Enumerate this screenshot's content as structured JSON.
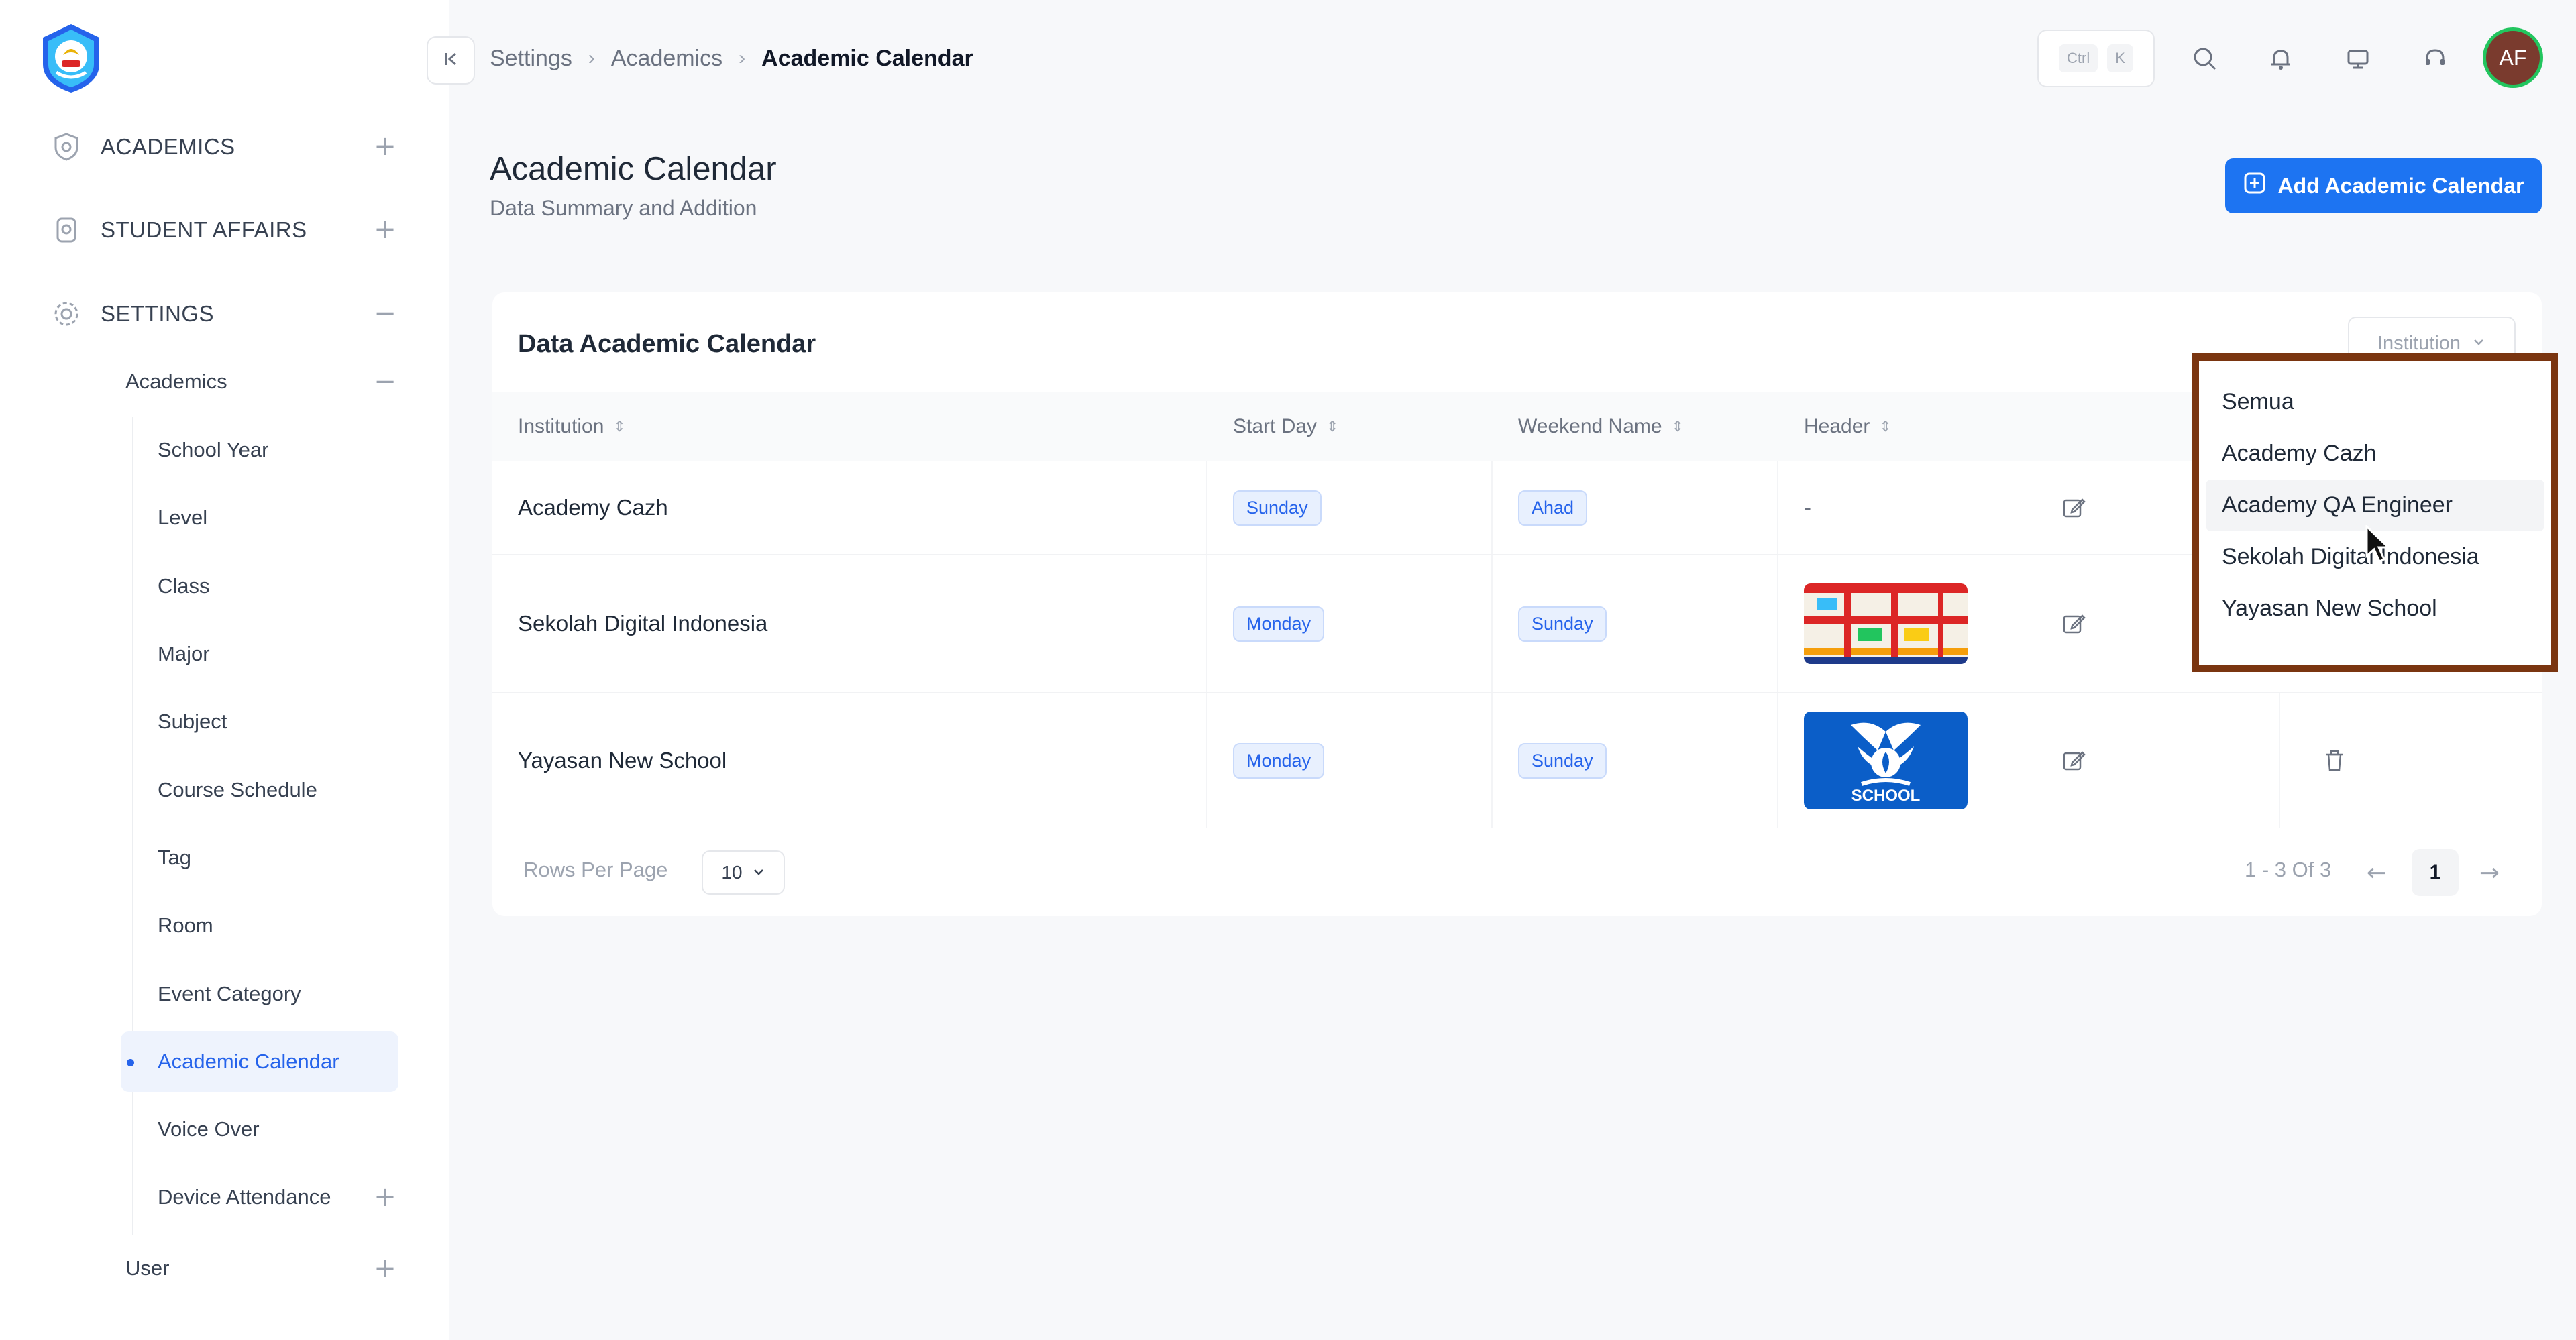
{
  "sidebar": {
    "sections": [
      {
        "label": "ACADEMICS",
        "toggle": "+"
      },
      {
        "label": "STUDENT AFFAIRS",
        "toggle": "+"
      },
      {
        "label": "SETTINGS",
        "toggle": "−"
      }
    ],
    "academics_group": {
      "label": "Academics",
      "toggle": "−"
    },
    "items": [
      {
        "label": "School Year"
      },
      {
        "label": "Level"
      },
      {
        "label": "Class"
      },
      {
        "label": "Major"
      },
      {
        "label": "Subject"
      },
      {
        "label": "Course Schedule"
      },
      {
        "label": "Tag"
      },
      {
        "label": "Room"
      },
      {
        "label": "Event Category"
      },
      {
        "label": "Academic Calendar",
        "active": true
      },
      {
        "label": "Voice Over"
      },
      {
        "label": "Device Attendance",
        "toggle": "+"
      }
    ],
    "user_group": {
      "label": "User",
      "toggle": "+"
    }
  },
  "topbar": {
    "breadcrumb": [
      "Settings",
      "Academics",
      "Academic Calendar"
    ],
    "shortcut": [
      "Ctrl",
      "K"
    ],
    "avatar_initials": "AF"
  },
  "page": {
    "title": "Academic Calendar",
    "subtitle": "Data Summary and Addition",
    "add_button": "Add Academic Calendar"
  },
  "card": {
    "title": "Data Academic Calendar",
    "filter_placeholder": "Institution",
    "columns": [
      "Institution",
      "Start Day",
      "Weekend Name",
      "Header"
    ],
    "rows": [
      {
        "institution": "Academy Cazh",
        "start_day": "Sunday",
        "weekend": "Ahad",
        "header": "-"
      },
      {
        "institution": "Sekolah Digital Indonesia",
        "start_day": "Monday",
        "weekend": "Sunday",
        "header": ""
      },
      {
        "institution": "Yayasan New School",
        "start_day": "Monday",
        "weekend": "Sunday",
        "header": ""
      }
    ],
    "thumb_school_text": "SCHOOL",
    "rows_per_page_label": "Rows Per Page",
    "rows_per_page_value": "10",
    "page_info": "1 - 3 Of 3",
    "current_page": "1"
  },
  "dropdown": {
    "options": [
      "Semua",
      "Academy Cazh",
      "Academy QA Engineer",
      "Sekolah Digital Indonesia",
      "Yayasan New School"
    ],
    "hovered_index": 2
  },
  "colors": {
    "accent": "#1d74f2",
    "highlight_border": "#7a3510",
    "avatar_bg": "#7a3b2e",
    "avatar_ring": "#22c55e"
  }
}
